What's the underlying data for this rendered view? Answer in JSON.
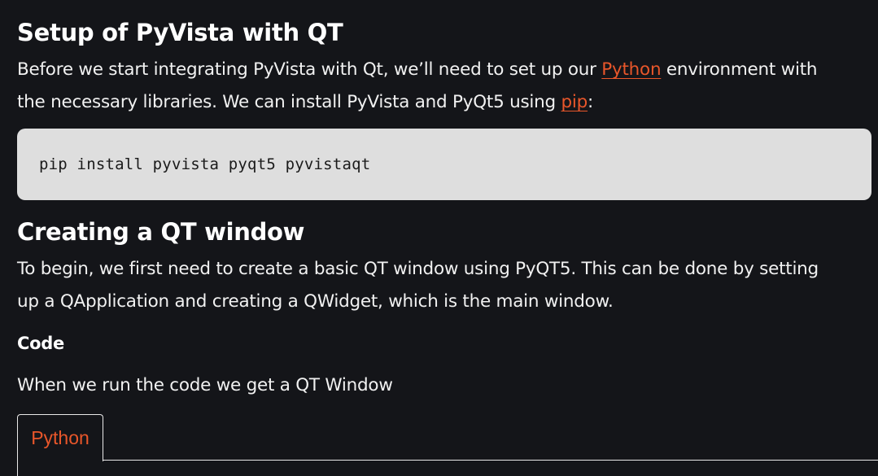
{
  "section1": {
    "heading": "Setup of PyVista with QT",
    "para": {
      "part1": "Before we start integrating PyVista with Qt, we’ll need to set up our ",
      "link1": "Python",
      "part2": " environment with",
      "line2_part1": "the necessary libraries. We can install PyVista and PyQt5 using ",
      "link2": "pip",
      "part3": ":"
    },
    "code": "pip install pyvista pyqt5 pyvistaqt"
  },
  "section2": {
    "heading": "Creating a QT window",
    "para_line1": "To begin, we first need to create a basic QT window using PyQT5. This can be done by setting",
    "para_line2": "up a QApplication and creating a QWidget, which is the main window.",
    "code_label": "Code",
    "result_text": "When we run the code we get a QT Window"
  },
  "tabs": [
    {
      "label": "Python"
    }
  ],
  "colors": {
    "background": "#141519",
    "text": "#f1f1f1",
    "link": "#e8562a",
    "code_bg": "#dedede"
  }
}
